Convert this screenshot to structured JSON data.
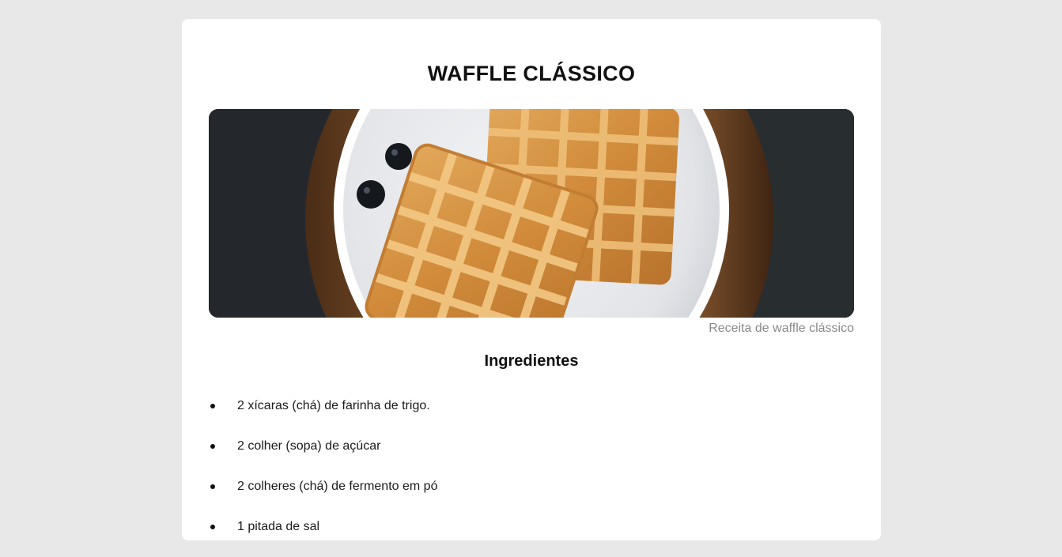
{
  "recipe": {
    "title": "WAFFLE CLÁSSICO",
    "image_caption": "Receita de waffle clássico",
    "ingredients_heading": "Ingredientes",
    "ingredients": [
      "2 xícaras (chá) de farinha de trigo.",
      "2 colher (sopa) de açúcar",
      "2 colheres (chá) de fermento em pó",
      "1 pitada de sal"
    ]
  },
  "colors": {
    "page_background": "#e8e8e8",
    "card_background": "#ffffff",
    "caption": "#8a8a8a",
    "text": "#111111"
  }
}
